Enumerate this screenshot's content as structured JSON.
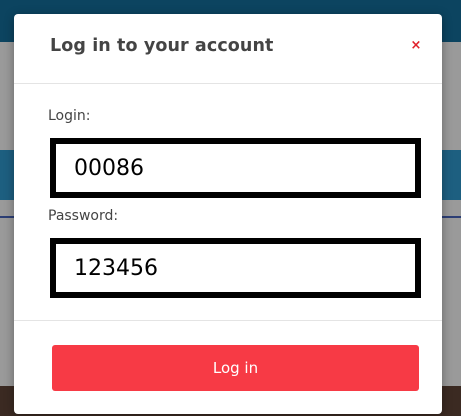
{
  "modal": {
    "title": "Log in to your account",
    "close_symbol": "×",
    "login_label": "Login:",
    "login_value": "00086",
    "password_label": "Password:",
    "password_value": "123456",
    "submit_label": "Log in"
  },
  "colors": {
    "accent": "#f73a45",
    "close": "#e0202a",
    "title_text": "#444444",
    "field_border": "#000000"
  },
  "icons": {
    "close": "close-icon"
  }
}
